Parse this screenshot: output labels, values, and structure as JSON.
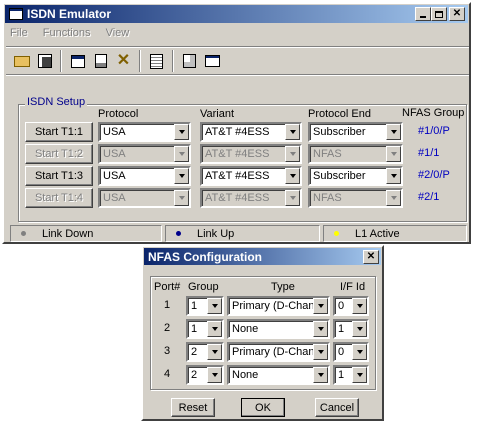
{
  "main_window": {
    "title": "ISDN Emulator",
    "menu": [
      "File",
      "Functions",
      "View"
    ],
    "toolbar_icons": [
      "open-folder-icon",
      "save-disk-icon",
      "window-icon",
      "properties-icon",
      "disconnect-icon",
      "document-list-icon",
      "search-document-icon",
      "terminal-window-icon"
    ],
    "setup_label": "ISDN Setup",
    "headers": {
      "protocol": "Protocol",
      "variant": "Variant",
      "protocol_end": "Protocol End",
      "nfas_group": "NFAS Group"
    },
    "rows": [
      {
        "button": "Start T1:1",
        "protocol": "USA",
        "variant": "AT&T #4ESS",
        "end": "Subscriber",
        "nfas": "#1/0/P",
        "enabled": true
      },
      {
        "button": "Start T1:2",
        "protocol": "USA",
        "variant": "AT&T #4ESS",
        "end": "NFAS",
        "nfas": "#1/1",
        "enabled": false
      },
      {
        "button": "Start T1:3",
        "protocol": "USA",
        "variant": "AT&T #4ESS",
        "end": "Subscriber",
        "nfas": "#2/0/P",
        "enabled": true
      },
      {
        "button": "Start T1:4",
        "protocol": "USA",
        "variant": "AT&T #4ESS",
        "end": "NFAS",
        "nfas": "#2/1",
        "enabled": false
      }
    ],
    "status": [
      {
        "label": "Link Down",
        "color": "#808080"
      },
      {
        "label": "Link Up",
        "color": "#00008b"
      },
      {
        "label": "L1 Active",
        "color": "#ffff00"
      }
    ]
  },
  "dialog": {
    "title": "NFAS Configuration",
    "headers": {
      "port": "Port#",
      "group": "Group",
      "type": "Type",
      "if_id": "I/F Id"
    },
    "rows": [
      {
        "port": "1",
        "group": "1",
        "type": "Primary (D-Chann",
        "if_id": "0"
      },
      {
        "port": "2",
        "group": "1",
        "type": "None",
        "if_id": "1"
      },
      {
        "port": "3",
        "group": "2",
        "type": "Primary (D-Chann",
        "if_id": "0"
      },
      {
        "port": "4",
        "group": "2",
        "type": "None",
        "if_id": "1"
      }
    ],
    "buttons": {
      "reset": "Reset",
      "ok": "OK",
      "cancel": "Cancel"
    }
  }
}
